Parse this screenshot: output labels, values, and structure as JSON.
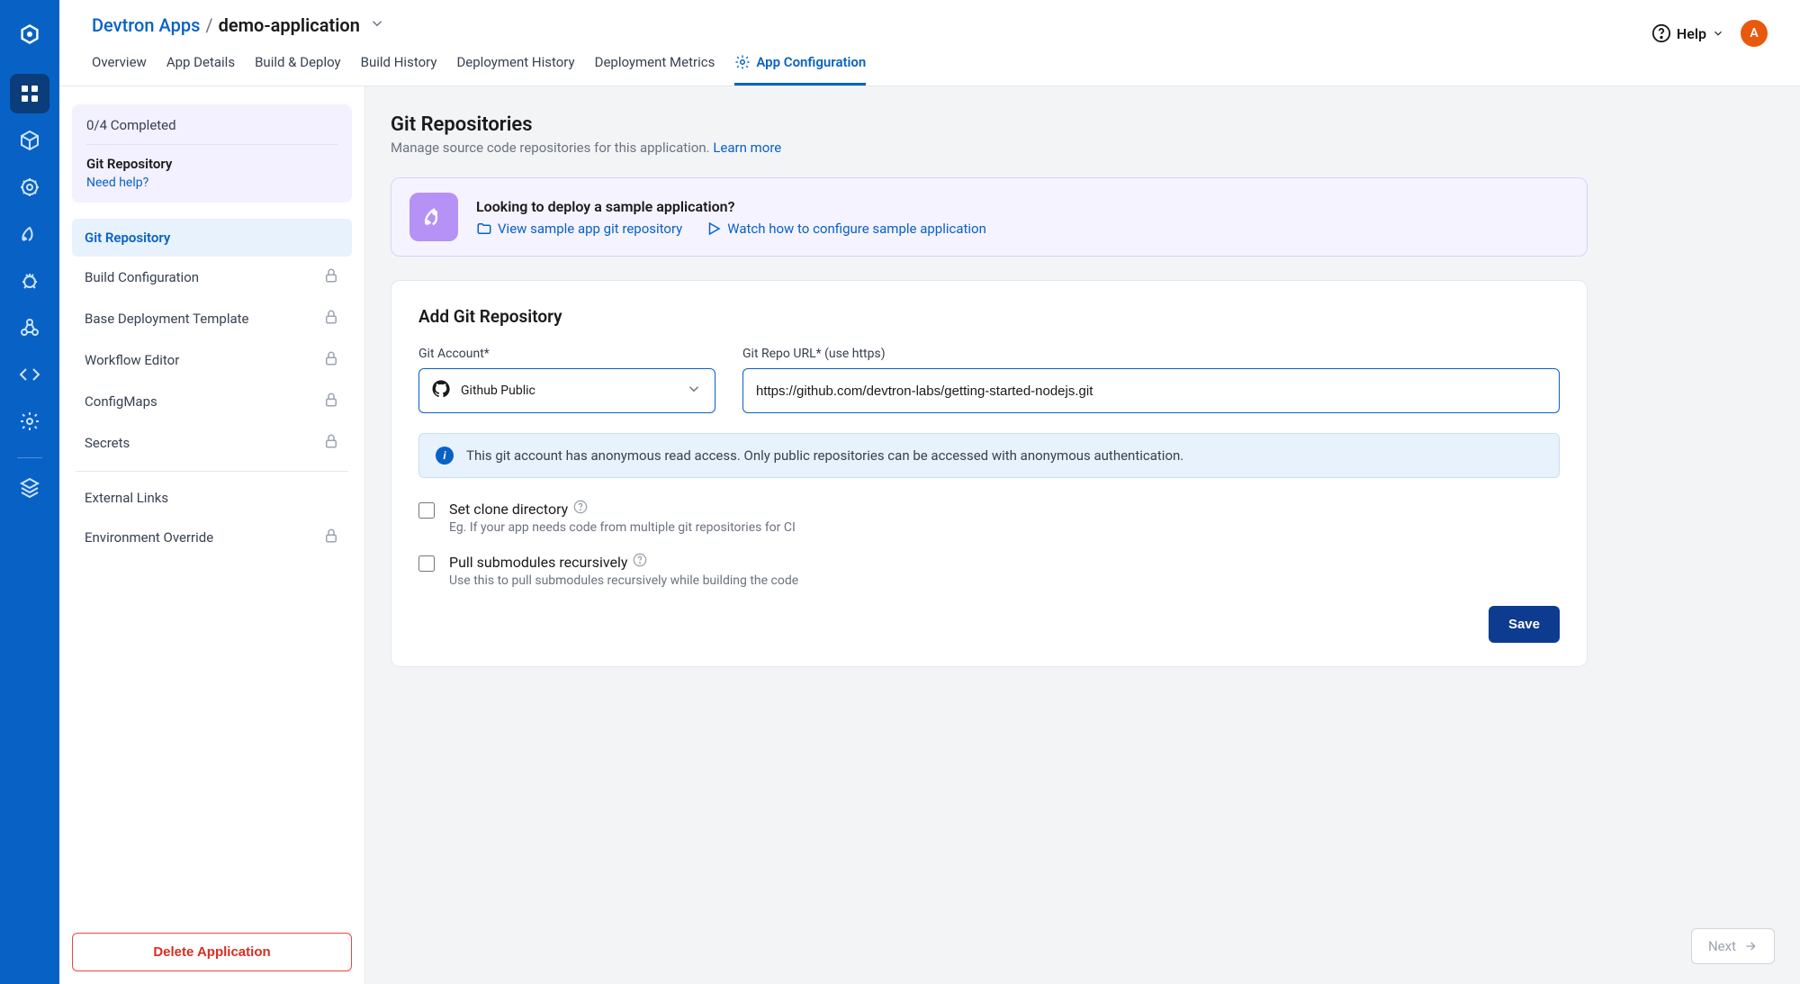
{
  "breadcrumb": {
    "root": "Devtron Apps",
    "sep": "/",
    "current": "demo-application"
  },
  "topbar": {
    "help": "Help",
    "avatar": "A"
  },
  "tabs": [
    {
      "label": "Overview"
    },
    {
      "label": "App Details"
    },
    {
      "label": "Build & Deploy"
    },
    {
      "label": "Build History"
    },
    {
      "label": "Deployment History"
    },
    {
      "label": "Deployment Metrics"
    },
    {
      "label": "App Configuration",
      "active": true
    }
  ],
  "progress": {
    "completed": "0/4 Completed",
    "title": "Git Repository",
    "help": "Need help?"
  },
  "config_nav": [
    {
      "label": "Git Repository",
      "active": true,
      "locked": false
    },
    {
      "label": "Build Configuration",
      "locked": true
    },
    {
      "label": "Base Deployment Template",
      "locked": true
    },
    {
      "label": "Workflow Editor",
      "locked": true
    },
    {
      "label": "ConfigMaps",
      "locked": true
    },
    {
      "label": "Secrets",
      "locked": true
    }
  ],
  "config_nav_extra": [
    {
      "label": "External Links",
      "locked": false
    },
    {
      "label": "Environment Override",
      "locked": true
    }
  ],
  "delete_button": "Delete Application",
  "page": {
    "title": "Git Repositories",
    "subtitle": "Manage source code repositories for this application. ",
    "learn_more": "Learn more"
  },
  "sample": {
    "title": "Looking to deploy a sample application?",
    "link1": "View sample app git repository",
    "link2": "Watch how to configure sample application"
  },
  "form": {
    "heading": "Add Git Repository",
    "account_label": "Git Account*",
    "account_value": "Github Public",
    "url_label": "Git Repo URL* (use https)",
    "url_value": "https://github.com/devtron-labs/getting-started-nodejs.git",
    "info": "This git account has anonymous read access. Only public repositories can be accessed with anonymous authentication.",
    "opt1_title": "Set clone directory",
    "opt1_sub": "Eg. If your app needs code from multiple git repositories for CI",
    "opt2_title": "Pull submodules recursively",
    "opt2_sub": "Use this to pull submodules recursively while building the code",
    "save": "Save"
  },
  "footer": {
    "next": "Next"
  }
}
